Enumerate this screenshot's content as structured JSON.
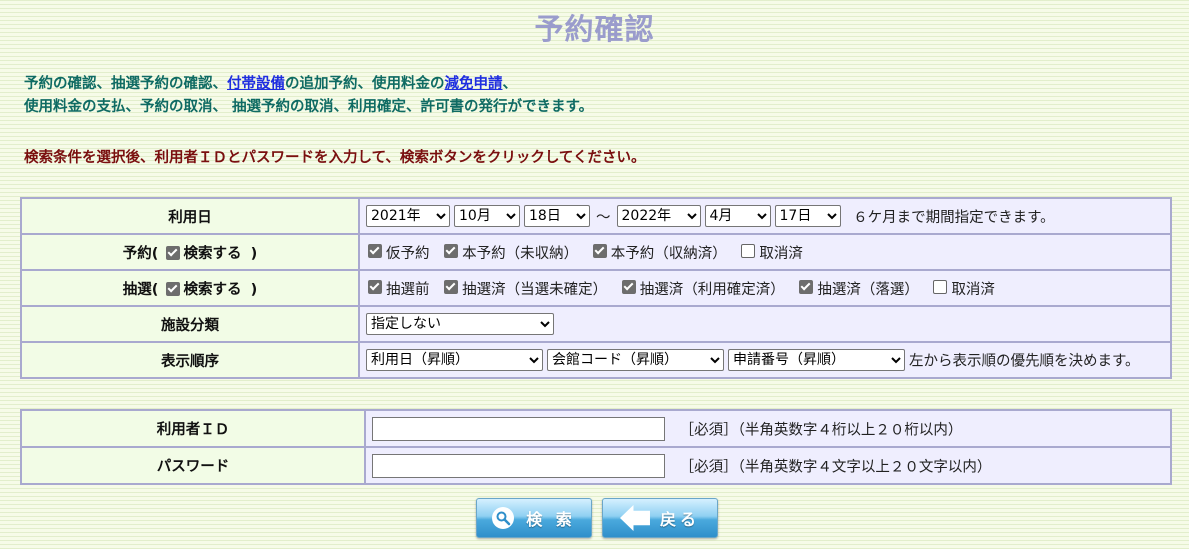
{
  "page": {
    "title": "予約確認"
  },
  "intro": {
    "line1_part1": "予約の確認、抽選予約の確認、",
    "link_equipment": "付帯設備",
    "line1_part2": "の追加予約、使用料金の",
    "link_reduction": "減免申請",
    "line1_part3": "、",
    "line2": "使用料金の支払、予約の取消、 抽選予約の取消、利用確定、許可書の発行ができます。"
  },
  "instruction": "検索条件を選択後、利用者ＩＤとパスワードを入力して、検索ボタンをクリックしてください。",
  "usage_date": {
    "label": "利用日",
    "from_year": "2021年",
    "from_month": "10月",
    "from_day": "18日",
    "tilde": "～",
    "to_year": "2022年",
    "to_month": "4月",
    "to_day": "17日",
    "note": "６ケ月まで期間指定できます。"
  },
  "reservation": {
    "label_prefix": "予約(",
    "label_check": "検索する",
    "label_suffix": ")",
    "options": [
      {
        "label": "仮予約",
        "checked": true
      },
      {
        "label": "本予約（未収納）",
        "checked": true
      },
      {
        "label": "本予約（収納済）",
        "checked": true
      },
      {
        "label": "取消済",
        "checked": false
      }
    ]
  },
  "lottery": {
    "label_prefix": "抽選(",
    "label_check": "検索する",
    "label_suffix": ")",
    "options": [
      {
        "label": "抽選前",
        "checked": true
      },
      {
        "label": "抽選済（当選未確定）",
        "checked": true
      },
      {
        "label": "抽選済（利用確定済）",
        "checked": true
      },
      {
        "label": "抽選済（落選）",
        "checked": true
      },
      {
        "label": "取消済",
        "checked": false
      }
    ]
  },
  "facility": {
    "label": "施設分類",
    "selected": "指定しない"
  },
  "sort_order": {
    "label": "表示順序",
    "sort1": "利用日（昇順）",
    "sort2": "会館コード（昇順）",
    "sort3": "申請番号（昇順）",
    "note": "左から表示順の優先順を決めます。"
  },
  "user_id": {
    "label": "利用者ＩＤ",
    "value": "",
    "note": "［必須］（半角英数字４桁以上２０桁以内）"
  },
  "password": {
    "label": "パスワード",
    "value": "",
    "note": "［必須］（半角英数字４文字以上２０文字以内）"
  },
  "buttons": {
    "search": "検 索",
    "back": "戻る"
  }
}
